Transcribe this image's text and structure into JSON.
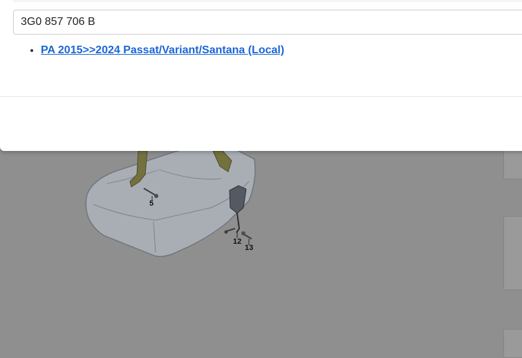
{
  "search": {
    "value": "3G0 857 706 B"
  },
  "results": [
    {
      "label": "PA 2015>>2024 Passat/Variant/Santana (Local)"
    }
  ],
  "diagram": {
    "callouts": [
      "5",
      "12",
      "13"
    ]
  }
}
